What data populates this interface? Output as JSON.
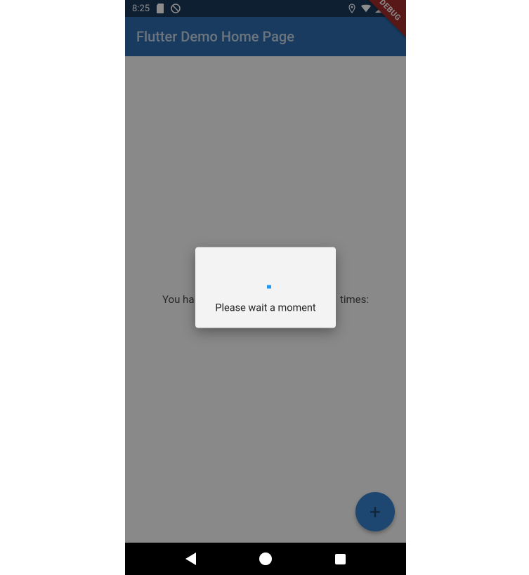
{
  "status": {
    "time": "8:25",
    "icons": {
      "sd": "sd-card-icon",
      "dnd": "do-not-disturb-icon",
      "location": "location-icon",
      "wifi": "wifi-icon",
      "signal": "signal-icon",
      "battery": "battery-icon"
    }
  },
  "app_bar": {
    "title": "Flutter Demo Home Page"
  },
  "debug_banner": "DEBUG",
  "body": {
    "counter_label_left": "You ha",
    "counter_label_right": " times:"
  },
  "dialog": {
    "message": "Please wait a moment"
  },
  "fab": {
    "label": "+"
  },
  "nav": {
    "back": "back-button",
    "home": "home-button",
    "recent": "recent-button"
  }
}
